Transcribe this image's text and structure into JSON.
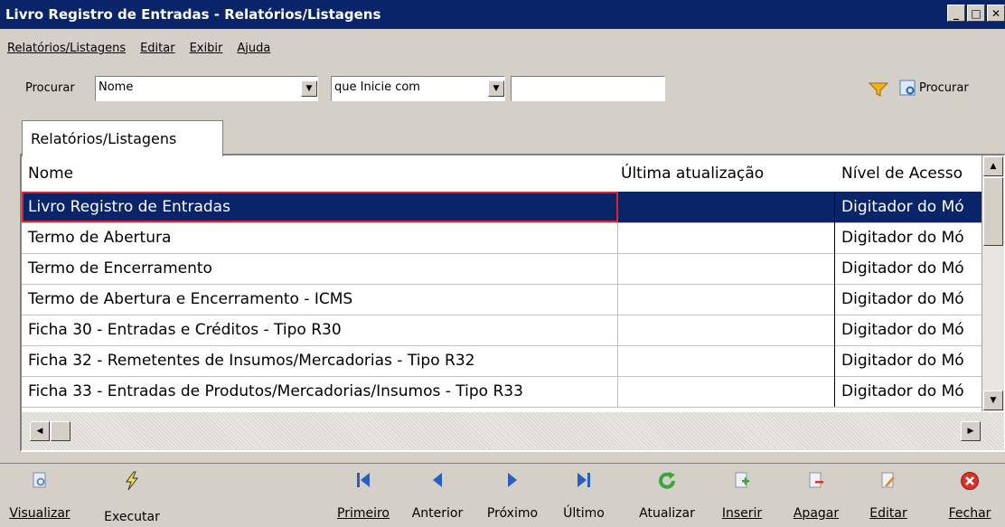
{
  "window": {
    "title": "Livro Registro de Entradas -  Relatórios/Listagens",
    "min_label": "_",
    "max_label": "□",
    "close_label": "✕"
  },
  "menu": [
    "Relatórios/Listagens",
    "Editar",
    "Exibir",
    "Ajuda"
  ],
  "search": {
    "label": "Procurar",
    "field_value": "Nome",
    "mode_value": "que Inicie com",
    "text_value": "",
    "button_label": "Procurar"
  },
  "tab_label": "Relatórios/Listagens",
  "grid": {
    "columns": [
      "Nome",
      "Última atualização",
      "Nível de Acesso"
    ],
    "rows": [
      {
        "nome": "Livro Registro de Entradas",
        "atualizacao": "",
        "nivel": "Digitador do Mó"
      },
      {
        "nome": "Termo de Abertura",
        "atualizacao": "",
        "nivel": "Digitador do Mó"
      },
      {
        "nome": "Termo de Encerramento",
        "atualizacao": "",
        "nivel": "Digitador do Mó"
      },
      {
        "nome": "Termo de Abertura e Encerramento - ICMS",
        "atualizacao": "",
        "nivel": "Digitador do Mó"
      },
      {
        "nome": "Ficha 30 - Entradas e Créditos - Tipo R30",
        "atualizacao": "",
        "nivel": "Digitador do Mó"
      },
      {
        "nome": "Ficha 32 - Remetentes de Insumos/Mercadorias - Tipo R32",
        "atualizacao": "",
        "nivel": "Digitador do Mó"
      },
      {
        "nome": "Ficha 33 - Entradas de Produtos/Mercadorias/Insumos - Tipo R33",
        "atualizacao": "",
        "nivel": "Digitador do Mó"
      }
    ]
  },
  "toolbar": {
    "visualizar": "Visualizar",
    "executar": "Executar",
    "primeiro": "Primeiro",
    "anterior": "Anterior",
    "proximo": "Próximo",
    "ultimo": "Último",
    "atualizar": "Atualizar",
    "inserir": "Inserir",
    "apagar": "Apagar",
    "editar": "Editar",
    "fechar": "Fechar"
  },
  "colors": {
    "titlebar": "#0a246a",
    "selection": "#0a246a",
    "highlight_outline": "#e0242c",
    "nav_blue": "#2a5fbf",
    "refresh_green": "#3aa63a",
    "close_red": "#d8322a"
  }
}
